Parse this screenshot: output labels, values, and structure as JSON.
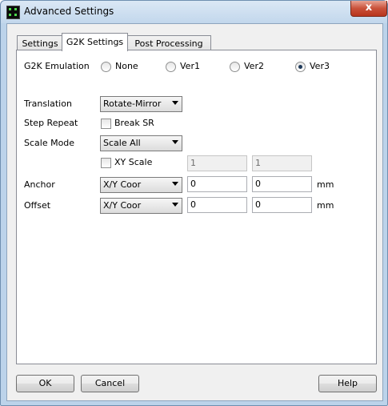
{
  "window": {
    "title": "Advanced Settings",
    "close_glyph": "x"
  },
  "tabs": [
    {
      "label": "Settings",
      "active": false
    },
    {
      "label": "G2K Settings",
      "active": true
    },
    {
      "label": "Post Processing",
      "active": false
    }
  ],
  "g2k": {
    "emulation_label": "G2K Emulation",
    "options": [
      {
        "label": "None",
        "checked": false
      },
      {
        "label": "Ver1",
        "checked": false
      },
      {
        "label": "Ver2",
        "checked": false
      },
      {
        "label": "Ver3",
        "checked": true
      }
    ]
  },
  "translation": {
    "label": "Translation",
    "value": "Rotate-Mirror"
  },
  "step_repeat": {
    "label": "Step Repeat",
    "checkbox_label": "Break SR",
    "checked": false
  },
  "scale_mode": {
    "label": "Scale  Mode",
    "value": "Scale All"
  },
  "xy_scale": {
    "checkbox_label": "XY Scale",
    "checked": false,
    "x": "1",
    "y": "1"
  },
  "anchor": {
    "label": "Anchor",
    "mode": "X/Y Coor",
    "x": "0",
    "y": "0",
    "unit": "mm"
  },
  "offset": {
    "label": "Offset",
    "mode": "X/Y Coor",
    "x": "0",
    "y": "0",
    "unit": "mm"
  },
  "buttons": {
    "ok": "OK",
    "cancel": "Cancel",
    "help": "Help"
  },
  "icons": {
    "app": "app-icon",
    "close": "close-icon",
    "dropdown": "chevron-down-icon"
  }
}
